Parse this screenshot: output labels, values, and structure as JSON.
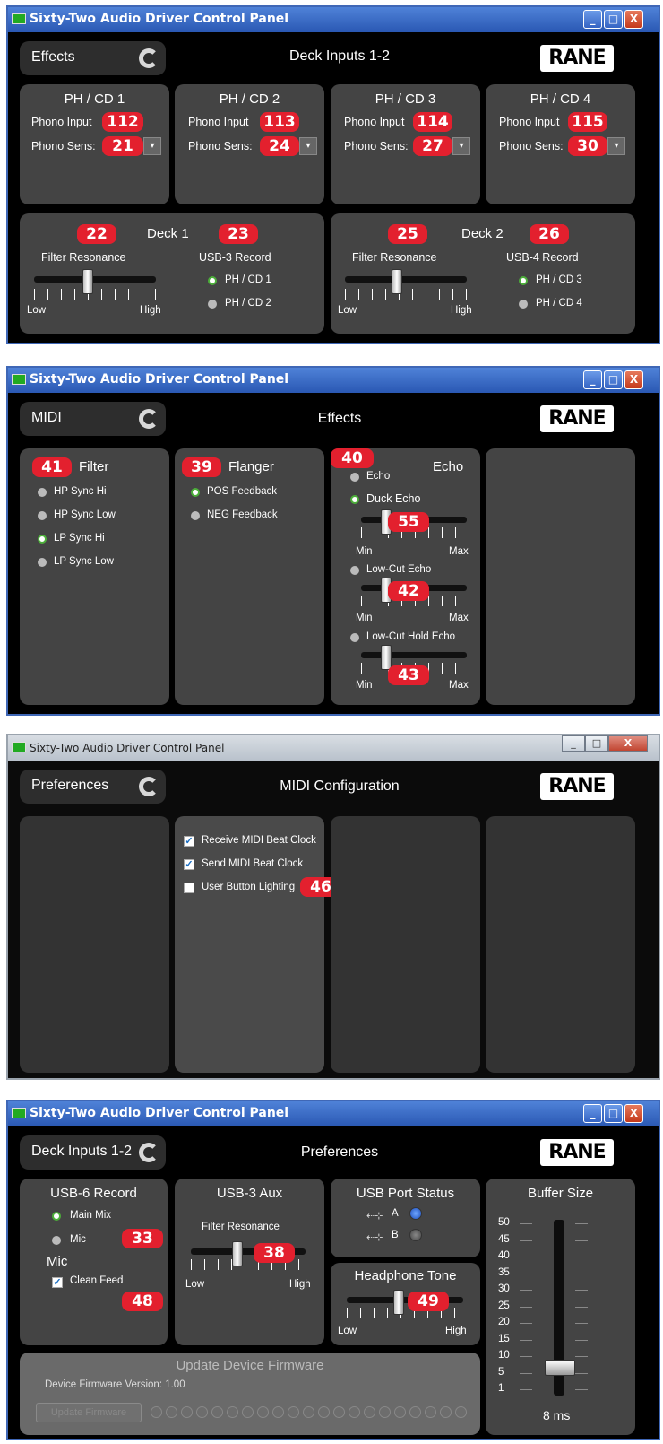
{
  "window_title": "Sixty-Two Audio Driver Control Panel",
  "brand": "RANE",
  "controls": {
    "minimize": "_",
    "maximize": "□",
    "close": "X"
  },
  "s1": {
    "nav": "Effects",
    "title": "Deck Inputs 1-2",
    "ch": [
      {
        "title": "PH / CD 1",
        "input_label": "Phono Input",
        "input_badge": "112",
        "sens_label": "Phono Sens:",
        "sens_badge": "21"
      },
      {
        "title": "PH / CD 2",
        "input_label": "Phono Input",
        "input_badge": "113",
        "sens_label": "Phono Sens:",
        "sens_badge": "24"
      },
      {
        "title": "PH / CD 3",
        "input_label": "Phono Input",
        "input_badge": "114",
        "sens_label": "Phono Sens:",
        "sens_badge": "27"
      },
      {
        "title": "PH / CD 4",
        "input_label": "Phono Input",
        "input_badge": "115",
        "sens_label": "Phono Sens:",
        "sens_badge": "30"
      }
    ],
    "decks": [
      {
        "title": "Deck 1",
        "badge_filter": "22",
        "badge_rec": "23",
        "filter_label": "Filter Resonance",
        "low": "Low",
        "high": "High",
        "rec_label": "USB-3 Record",
        "opt1": "PH / CD 1",
        "opt2": "PH / CD 2",
        "selected": 1
      },
      {
        "title": "Deck 2",
        "badge_filter": "25",
        "badge_rec": "26",
        "filter_label": "Filter Resonance",
        "low": "Low",
        "high": "High",
        "rec_label": "USB-4 Record",
        "opt1": "PH / CD 3",
        "opt2": "PH / CD 4",
        "selected": 1
      }
    ]
  },
  "s2": {
    "nav": "MIDI",
    "title": "Effects",
    "filter": {
      "title": "Filter",
      "badge": "41",
      "opts": [
        "HP Sync Hi",
        "HP Sync Low",
        "LP Sync Hi",
        "LP Sync Low"
      ],
      "selected": 3
    },
    "flanger": {
      "title": "Flanger",
      "badge": "39",
      "opts": [
        "POS Feedback",
        "NEG Feedback"
      ],
      "selected": 1
    },
    "echo": {
      "title": "Echo",
      "badge": "40",
      "opt_echo": "Echo",
      "opt_duck": "Duck Echo",
      "badge_duck": "55",
      "opt_lowcut": "Low-Cut Echo",
      "badge_lowcut": "42",
      "opt_hold": "Low-Cut Hold Echo",
      "badge_hold": "43",
      "min": "Min",
      "max": "Max",
      "selected": "Duck Echo"
    }
  },
  "s3": {
    "nav": "Preferences",
    "title": "MIDI Configuration",
    "opts": [
      {
        "label": "Receive MIDI Beat Clock",
        "checked": true
      },
      {
        "label": "Send MIDI Beat Clock",
        "checked": true
      },
      {
        "label": "User Button Lighting",
        "checked": false
      }
    ],
    "badge": "46"
  },
  "s4": {
    "nav": "Deck Inputs 1-2",
    "title": "Preferences",
    "usb6": {
      "title": "USB-6 Record",
      "opt1": "Main Mix",
      "opt2": "Mic",
      "badge": "33",
      "mic_title": "Mic",
      "clean_feed": "Clean Feed",
      "badge_clean": "48"
    },
    "usb3aux": {
      "title": "USB-3 Aux",
      "filter_label": "Filter Resonance",
      "badge": "38",
      "low": "Low",
      "high": "High"
    },
    "portstatus": {
      "title": "USB Port Status",
      "a": "A",
      "b": "B"
    },
    "headphone": {
      "title": "Headphone Tone",
      "badge": "49",
      "low": "Low",
      "high": "High"
    },
    "buffer": {
      "title": "Buffer Size",
      "ticks": [
        "50",
        "45",
        "40",
        "35",
        "30",
        "25",
        "20",
        "15",
        "10",
        "5",
        "1"
      ],
      "value": "8 ms"
    },
    "firmware": {
      "title": "Update Device Firmware",
      "version": "Device Firmware Version: 1.00",
      "button": "Update Firmware"
    }
  }
}
